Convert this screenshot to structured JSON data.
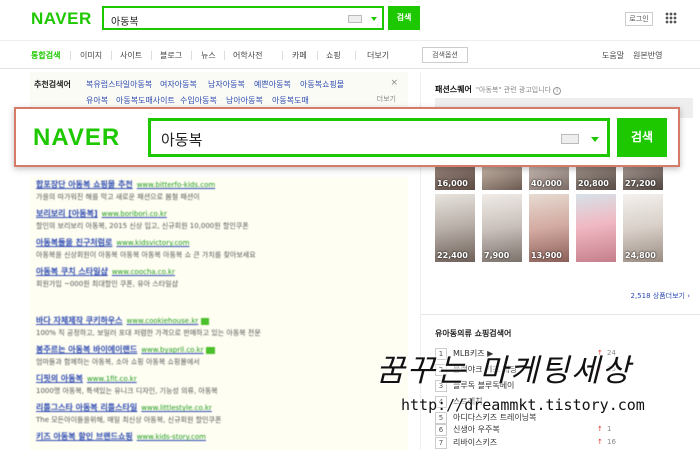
{
  "header": {
    "logo": "NAVER",
    "query": "아동복",
    "search_label": "검색",
    "login_label": "로그인"
  },
  "nav": {
    "tabs": [
      "통합검색",
      "이미지",
      "사이트",
      "블로그",
      "뉴스",
      "어학사전",
      "카페",
      "쇼핑",
      "더보기"
    ],
    "active": "통합검색",
    "search_options": "검색옵션",
    "right_links": [
      "도움말",
      "원본반영"
    ]
  },
  "recommended": {
    "label": "추천검색어",
    "row1": [
      "복유럽스타일아동복",
      "여자아동복",
      "남자아동복",
      "예쁜아동복",
      "아동복쇼핑몰"
    ],
    "row2": [
      "유아복",
      "아동복도매사이트",
      "수입아동복",
      "남아아동복",
      "아동복도매"
    ],
    "more": "더보기",
    "close": "×"
  },
  "ads": [
    {
      "title": "합포장단 아동복 쇼핑몰 추천",
      "url": "www.bitterfo-kids.com",
      "desc": "가을의 따가워진 해를 막고 새로운 패션으로 봄철 패션이"
    },
    {
      "title": "보리보리 [아동복]",
      "url": "www.boribori.co.kr",
      "desc": "할인의 보리보리 아동복, 2015 신상 입고, 신규회원 10,000원 할인쿠폰"
    },
    {
      "title": "아동복들을 친구처럼로",
      "url": "www.kidsvictory.com",
      "desc": "아동복을 신상회원이 아동복 아동복 아동복 아동복 쇼 큰 가치를 찾아보세요"
    },
    {
      "title": "아동복 쿠치 스타일샵",
      "url": "www.coocha.co.kr",
      "desc": "회원가입 ~000원 최대할인 쿠폰, 유아 스타일샵"
    },
    {
      "title": "바다 자체제작 쿠키하우스",
      "url": "www.cookiehouse.kr",
      "desc": "100% 직 공정하고, 보일러 포대 저렴한 가격으로 판매하고 있는 아동복 전문"
    },
    {
      "title": "봉주르는 아동복 바이에이랜드",
      "url": "www.byapril.co.kr",
      "desc": "엄마들과 함께하는 아동복, 소아 쇼핑 아동복 쇼핑몰에서"
    },
    {
      "title": "디핏의 아동복",
      "url": "www.1fit.co.kr",
      "desc": "1000명 아동복, 특색있는 유니크 디자인, 기능성 의류, 아동복"
    },
    {
      "title": "리틀그스타 아동복 리틀스타일",
      "url": "www.littlestyle.co.kr",
      "desc": "The 모든아이들을위해, 매일 최신상 아동복, 신규회원 할인쿠폰"
    },
    {
      "title": "키즈 아동복 할인 브랜드쇼핑",
      "url": "www.kids-story.com",
      "desc": ""
    }
  ],
  "fashion_square": {
    "title": "패션스퀘어",
    "subtitle": "\"아동복\" 관련 광고입니다",
    "ad_icon": "i",
    "row1_prices": [
      "16,000",
      "",
      "40,000",
      "20,800",
      "27,200"
    ],
    "row2_prices": [
      "22,400",
      "7,900",
      "13,900",
      "",
      "24,800"
    ],
    "more_link": "2,518 상품더보기 ›"
  },
  "shopping_ranking": {
    "title": "유아동의류 쇼핑검색어",
    "items": [
      {
        "n": "1",
        "label": "MLB키즈 ▶",
        "count": "24"
      },
      {
        "n": "2",
        "label": "블랙야크 키즈 패딩",
        "count": "15"
      },
      {
        "n": "3",
        "label": "블루독 블루독베이",
        "count": ""
      },
      {
        "n": "4",
        "label": "스트레치",
        "count": ""
      },
      {
        "n": "5",
        "label": "아디다스키즈 트레이닝복",
        "count": ""
      },
      {
        "n": "6",
        "label": "신생아 우주복",
        "count": "1"
      },
      {
        "n": "7",
        "label": "리바이스키즈",
        "count": "16"
      }
    ]
  },
  "overlay": {
    "logo": "NAVER",
    "query": "아동복",
    "search_label": "검색"
  },
  "watermark": {
    "line1": "꿈꾸는 마케팅세상",
    "line2": "http://dreammkt.tistory.com"
  },
  "colors": {
    "brand_green": "#1ec800",
    "link_blue": "#2d4ab1",
    "ad_bg": "#fffef2",
    "overlay_border": "#d57b6a"
  },
  "icons": [
    "keyboard-icon",
    "dropdown-arrow-icon",
    "apps-grid-icon",
    "close-icon",
    "info-icon"
  ]
}
